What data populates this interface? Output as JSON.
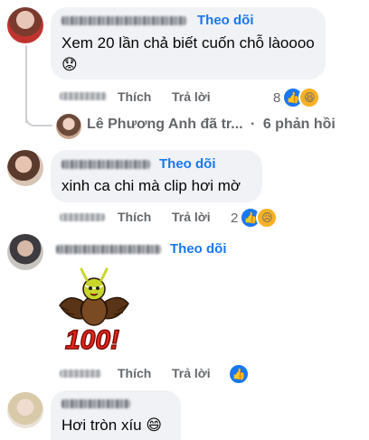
{
  "comments": [
    {
      "follow_label": "Theo dõi",
      "text": "Xem 20 lần chả biết cuốn chỗ làoooo",
      "emoji": "😟",
      "actions": {
        "like": "Thích",
        "reply": "Trả lời"
      },
      "reaction_count": "8",
      "reactions": [
        "like-icon",
        "haha-icon"
      ]
    },
    {
      "follow_label": "Theo dõi",
      "text": "xinh ca chi mà clip hơi mờ",
      "actions": {
        "like": "Thích",
        "reply": "Trả lời"
      },
      "reaction_count": "2",
      "reactions": [
        "like-icon",
        "sad-icon"
      ]
    },
    {
      "follow_label": "Theo dõi",
      "sticker_text": "100!",
      "actions": {
        "like": "Thích",
        "reply": "Trả lời"
      },
      "reactions": [
        "like-icon"
      ]
    },
    {
      "text": "Hơi tròn xíu",
      "emoji": "😄"
    }
  ],
  "reply_summary": {
    "name": "Lê Phương Anh đã tr...",
    "separator": "·",
    "count_label": "6 phản hồi"
  },
  "colors": {
    "accent": "#1877f2",
    "bubble": "#f0f2f5",
    "meta": "#65676b"
  }
}
